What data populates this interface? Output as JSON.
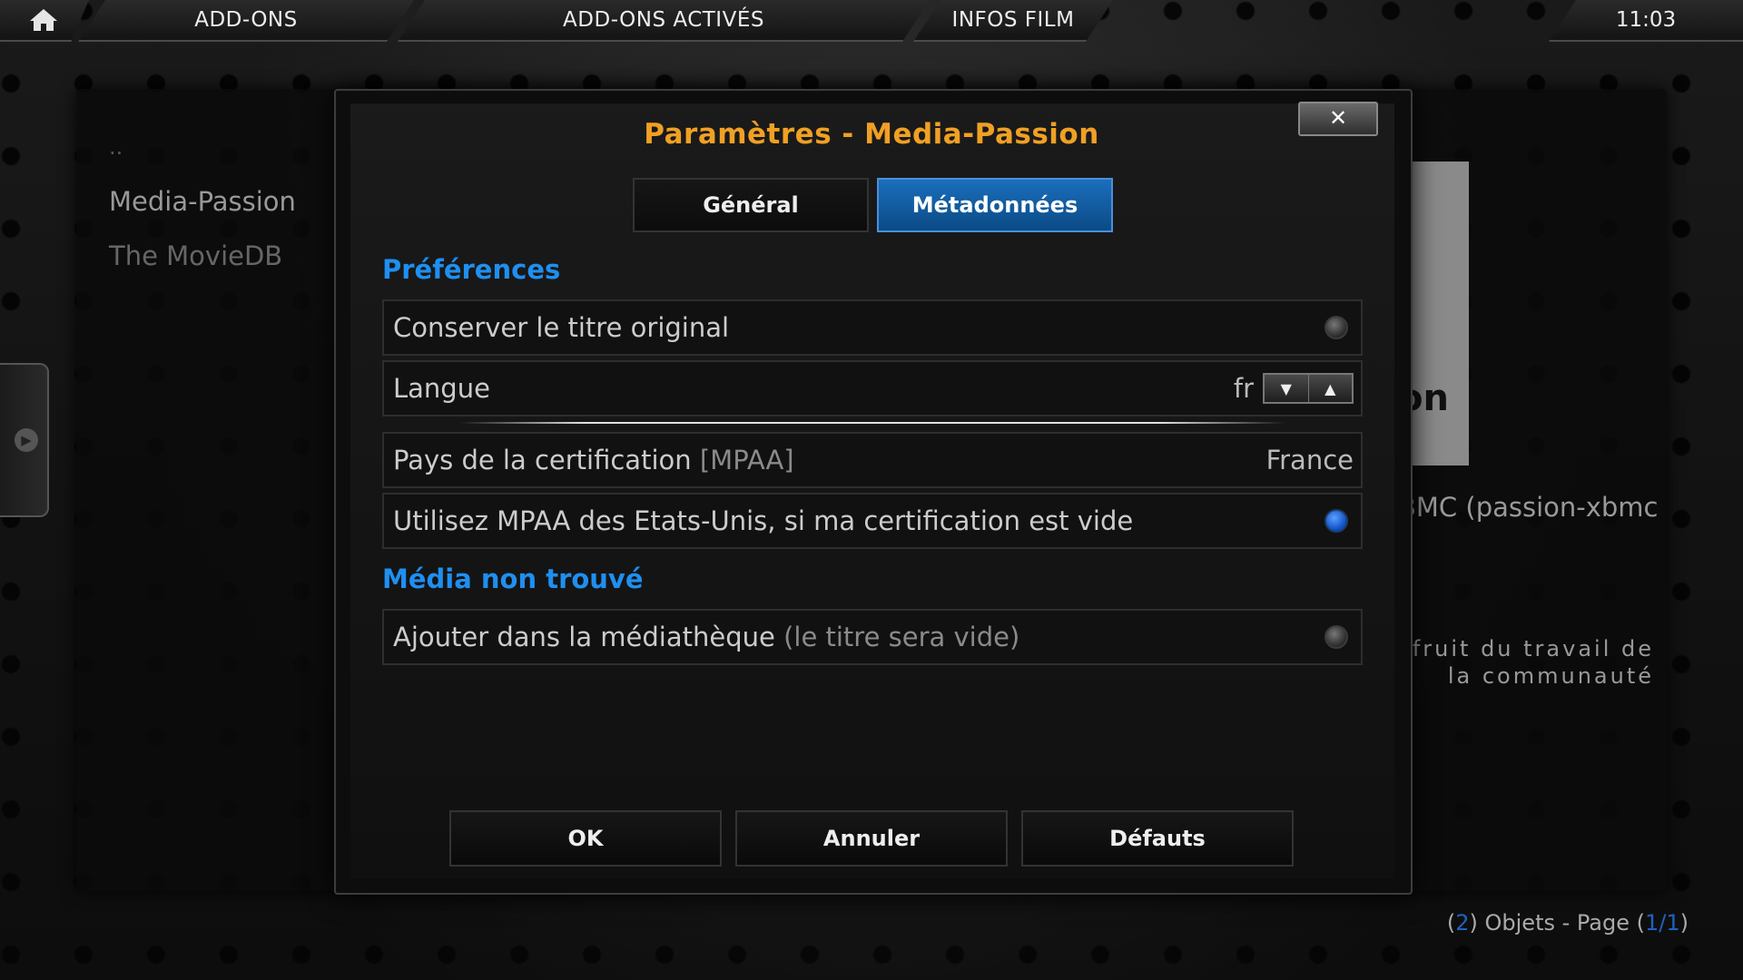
{
  "topbar": {
    "tabs": [
      "ADD-ONS",
      "ADD-ONS ACTIVÉS",
      "INFOS FILM"
    ],
    "clock": "11:03"
  },
  "background": {
    "list": [
      "..",
      "Media-Passion",
      "The MovieDB"
    ],
    "title_fragment": "n",
    "poster_text": "on",
    "description": "BMC (passion-xbmc",
    "quote": "fruit du travail de la communauté",
    "footer": {
      "count_open": "(",
      "count": "2",
      "count_text": ") Objets - Page (",
      "page": "1/1",
      "page_close": ")"
    }
  },
  "dialog": {
    "title": "Paramètres - Media-Passion",
    "close_symbol": "✕",
    "tabs": {
      "general": "Général",
      "metadata": "Métadonnées"
    },
    "sections": [
      {
        "title": "Préférences"
      },
      {
        "title": "Média non trouvé"
      }
    ],
    "settings": {
      "keep_title": {
        "label": "Conserver le titre original",
        "enabled": false
      },
      "language": {
        "label": "Langue",
        "value": "fr"
      },
      "cert_country": {
        "label": "Pays de la certification",
        "label_suffix": "[MPAA]",
        "value": "France"
      },
      "use_mpaa": {
        "label": "Utilisez MPAA des Etats-Unis, si ma certification est vide",
        "enabled": true
      },
      "add_library": {
        "label": "Ajouter dans la médiathèque",
        "label_suffix": "(le titre sera vide)",
        "enabled": false
      }
    },
    "buttons": {
      "ok": "OK",
      "cancel": "Annuler",
      "defaults": "Défauts"
    }
  },
  "colors": {
    "title": "#f0a024",
    "section": "#1f8ff0",
    "tab_active": "#1a6fbd",
    "radio_on": "#1e62e0"
  },
  "icons": [
    "home-icon",
    "close-icon",
    "arrow-down-icon",
    "arrow-up-icon",
    "chevron-right-icon"
  ]
}
